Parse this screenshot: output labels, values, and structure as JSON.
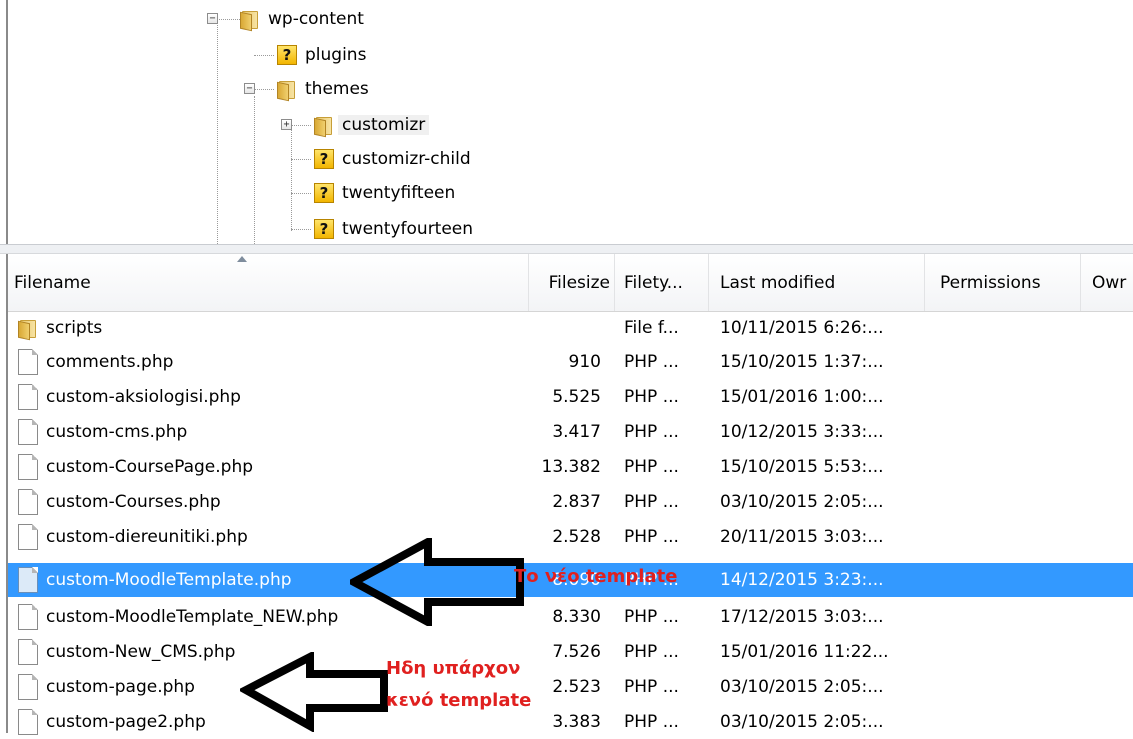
{
  "tree": {
    "nodes": [
      {
        "label": "wp-content",
        "icon": "folder-icon",
        "expander": "minus"
      },
      {
        "label": "plugins",
        "icon": "unknown-icon",
        "expander": ""
      },
      {
        "label": "themes",
        "icon": "folder-icon",
        "expander": "minus"
      },
      {
        "label": "customizr",
        "icon": "folder-icon",
        "expander": "plus"
      },
      {
        "label": "customizr-child",
        "icon": "unknown-icon",
        "expander": ""
      },
      {
        "label": "twentyfifteen",
        "icon": "unknown-icon",
        "expander": ""
      },
      {
        "label": "twentyfourteen",
        "icon": "unknown-icon",
        "expander": ""
      }
    ]
  },
  "list": {
    "columns": [
      "Filename",
      "Filesize",
      "Filety...",
      "Last modified",
      "Permissions",
      "Owr"
    ],
    "rows": [
      {
        "name": "scripts",
        "size": "",
        "type": "File f...",
        "modified": "10/11/2015 6:26:...",
        "icon": "folder-icon"
      },
      {
        "name": "comments.php",
        "size": "910",
        "type": "PHP ...",
        "modified": "15/10/2015 1:37:...",
        "icon": "file-icon"
      },
      {
        "name": "custom-aksiologisi.php",
        "size": "5.525",
        "type": "PHP ...",
        "modified": "15/01/2016 1:00:...",
        "icon": "file-icon"
      },
      {
        "name": "custom-cms.php",
        "size": "3.417",
        "type": "PHP ...",
        "modified": "10/12/2015 3:33:...",
        "icon": "file-icon"
      },
      {
        "name": "custom-CoursePage.php",
        "size": "13.382",
        "type": "PHP ...",
        "modified": "15/10/2015 5:53:...",
        "icon": "file-icon"
      },
      {
        "name": "custom-Courses.php",
        "size": "2.837",
        "type": "PHP ...",
        "modified": "03/10/2015 2:05:...",
        "icon": "file-icon"
      },
      {
        "name": "custom-diereunitiki.php",
        "size": "2.528",
        "type": "PHP ...",
        "modified": "20/11/2015 3:03:...",
        "icon": "file-icon"
      },
      {
        "name": "custom-MoodleTemplate.php",
        "size": "8.090",
        "type": "PHP ...",
        "modified": "14/12/2015 3:23:...",
        "icon": "file-icon",
        "selected": true
      },
      {
        "name": "custom-MoodleTemplate_NEW.php",
        "size": "8.330",
        "type": "PHP ...",
        "modified": "17/12/2015 3:03:...",
        "icon": "file-icon"
      },
      {
        "name": "custom-New_CMS.php",
        "size": "7.526",
        "type": "PHP ...",
        "modified": "15/01/2016 11:22...",
        "icon": "file-icon"
      },
      {
        "name": "custom-page.php",
        "size": "2.523",
        "type": "PHP ...",
        "modified": "03/10/2015 2:05:...",
        "icon": "file-icon"
      },
      {
        "name": "custom-page2.php",
        "size": "3.383",
        "type": "PHP ...",
        "modified": "03/10/2015 2:05:...",
        "icon": "file-icon"
      }
    ]
  },
  "annotations": {
    "new_template": "Το νέο template",
    "existing_line1": "Ηδη υπάρχον",
    "existing_line2": "κενό template",
    "color": "#e0201f"
  },
  "colors": {
    "selection": "#3399ff"
  }
}
